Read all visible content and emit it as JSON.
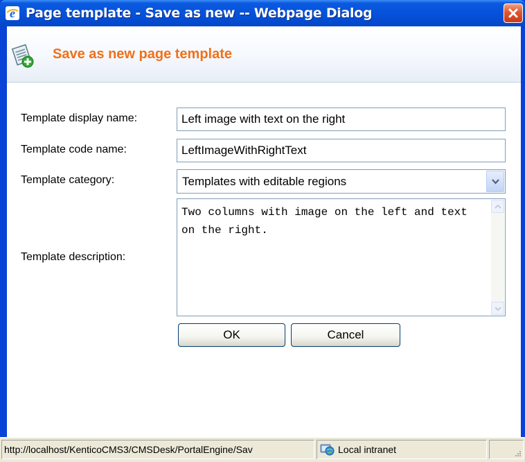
{
  "window": {
    "title": "Page template - Save as new -- Webpage Dialog"
  },
  "header": {
    "title": "Save as new page template",
    "icon": "template-add-icon"
  },
  "form": {
    "display_name": {
      "label": "Template display name:",
      "value": "Left image with text on the right"
    },
    "code_name": {
      "label": "Template code name:",
      "value": "LeftImageWithRightText"
    },
    "category": {
      "label": "Template category:",
      "selected": "Templates with editable regions"
    },
    "description": {
      "label": "Template description:",
      "value": "Two columns with image on the left and text on the right."
    }
  },
  "buttons": {
    "ok": "OK",
    "cancel": "Cancel"
  },
  "statusbar": {
    "url": "http://localhost/KenticoCMS3/CMSDesk/PortalEngine/Sav",
    "zone": "Local intranet"
  },
  "colors": {
    "title_accent": "#f07019",
    "titlebar": "#0550d8"
  }
}
